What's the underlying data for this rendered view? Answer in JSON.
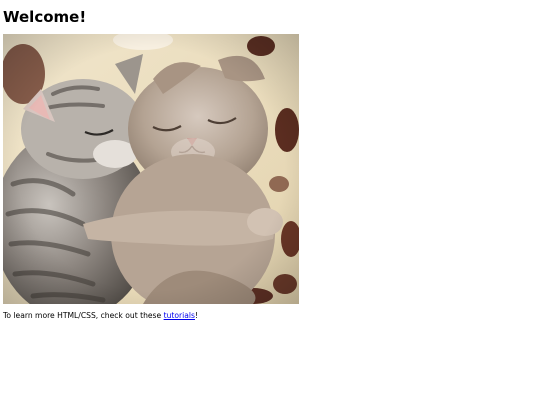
{
  "page": {
    "heading": "Welcome!",
    "image_description_name": "two-kittens-photo",
    "footer": {
      "text_before_link": "To learn more HTML/CSS, check out these ",
      "link_label": "tutorials",
      "text_after_link": "!"
    },
    "colors": {
      "link": "#0000ee",
      "text": "#000000",
      "background": "#ffffff"
    }
  }
}
